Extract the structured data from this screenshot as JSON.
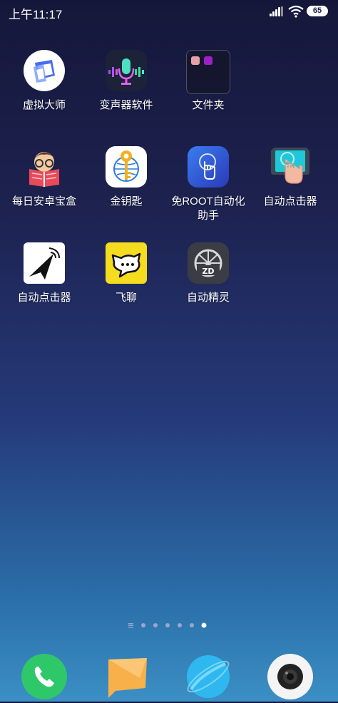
{
  "status": {
    "time": "上午11:17",
    "battery": "65"
  },
  "apps": [
    {
      "label": "虚拟大师"
    },
    {
      "label": "变声器软件"
    },
    {
      "label": "文件夹"
    },
    {
      "label": "每日安卓宝盒"
    },
    {
      "label": "金钥匙"
    },
    {
      "label": "免ROOT自动化助手"
    },
    {
      "label": "自动点击器"
    },
    {
      "label": "自动点击器"
    },
    {
      "label": "飞聊"
    },
    {
      "label": "自动精灵"
    }
  ],
  "page_indicator": {
    "pages": 6,
    "current": 6
  },
  "dock": [
    "phone",
    "messages",
    "browser",
    "camera"
  ]
}
